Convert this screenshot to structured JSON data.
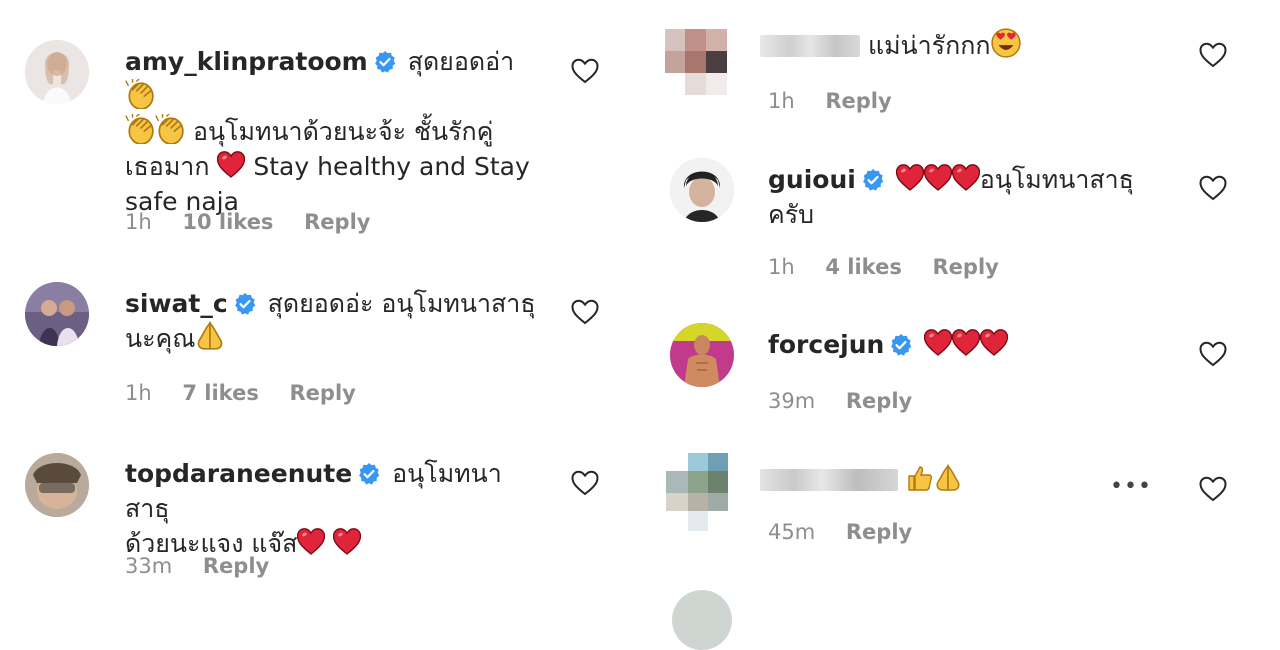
{
  "comments": [
    {
      "username": "amy_klinpratoom",
      "line1": "สุดยอดอ่า",
      "line2": "อนุโมทนาด้วยนะจ้ะ ชั้นรักคู่",
      "line3": "เธอมาก",
      "line3b": "Stay healthy and Stay",
      "line4": "safe naja",
      "time": "1h",
      "likes": "10 likes",
      "reply": "Reply"
    },
    {
      "username": "siwat_c",
      "line1": "สุดยอดอ่ะ อนุโมทนาสาธุ",
      "line2": "นะคุณ",
      "time": "1h",
      "likes": "7 likes",
      "reply": "Reply"
    },
    {
      "username": "topdaraneenute",
      "line1": "อนุโมทนาสาธุ",
      "line2": "ด้วยนะแจง แจ๊ส",
      "time": "33m",
      "reply": "Reply"
    },
    {
      "username": "",
      "line1": "แม่น่ารักกก",
      "time": "1h",
      "reply": "Reply"
    },
    {
      "username": "guioui",
      "line1": "อนุโมทนาสาธุ",
      "line2": "ครับ",
      "time": "1h",
      "likes": "4 likes",
      "reply": "Reply"
    },
    {
      "username": "forcejun",
      "time": "39m",
      "reply": "Reply"
    },
    {
      "username": "",
      "time": "45m",
      "reply": "Reply",
      "more": "•••"
    }
  ],
  "colors": {
    "heart": "#e0243a",
    "verified": "#3897f0",
    "meta": "#8e8e8e"
  },
  "icons": [
    "verified-badge-icon",
    "like-heart-outline-icon",
    "clapping-hands-emoji",
    "red-heart-emoji",
    "folded-hands-emoji",
    "heart-eyes-emoji",
    "thumbs-up-emoji",
    "more-options-icon"
  ]
}
